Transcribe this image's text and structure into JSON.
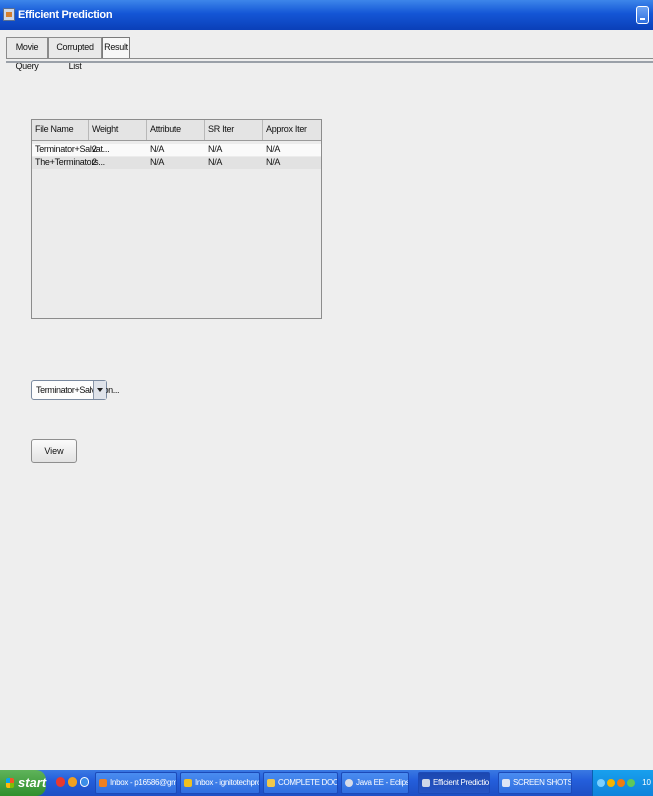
{
  "window": {
    "title": "Efficient Prediction"
  },
  "tabs": [
    {
      "label": "Movie Query"
    },
    {
      "label": "Corrupted List"
    },
    {
      "label": "Result",
      "active": true
    }
  ],
  "table": {
    "columns": [
      "File Name",
      "Weight",
      "Attribute",
      "SR Iter",
      "Approx Iter"
    ],
    "rows": [
      [
        "Terminator+Salvat...",
        "2",
        "N/A",
        "N/A",
        "N/A"
      ],
      [
        "The+Terminators...",
        "2",
        "N/A",
        "N/A",
        "N/A"
      ]
    ]
  },
  "combo": {
    "selected": "Terminator+Salvation..."
  },
  "view_button": {
    "label": "View"
  },
  "taskbar": {
    "start_label": "start",
    "buttons": [
      {
        "label": "Inbox - p16586@gm...",
        "icon": "mail-icon"
      },
      {
        "label": "Inbox - ignitotechpro...",
        "icon": "chrome-icon"
      },
      {
        "label": "COMPLETE DOCUME...",
        "icon": "folder-icon"
      },
      {
        "label": "Java EE - Eclipse",
        "icon": "eclipse-icon"
      },
      {
        "label": "Efficient Prediction",
        "icon": "java-icon",
        "active": true
      },
      {
        "label": "SCREEN SHOTS - Micr...",
        "icon": "word-icon"
      }
    ],
    "clock": "10"
  },
  "colors": {
    "titlebar": "#1456d6",
    "taskbar": "#245edb",
    "start": "#3a9a36"
  }
}
